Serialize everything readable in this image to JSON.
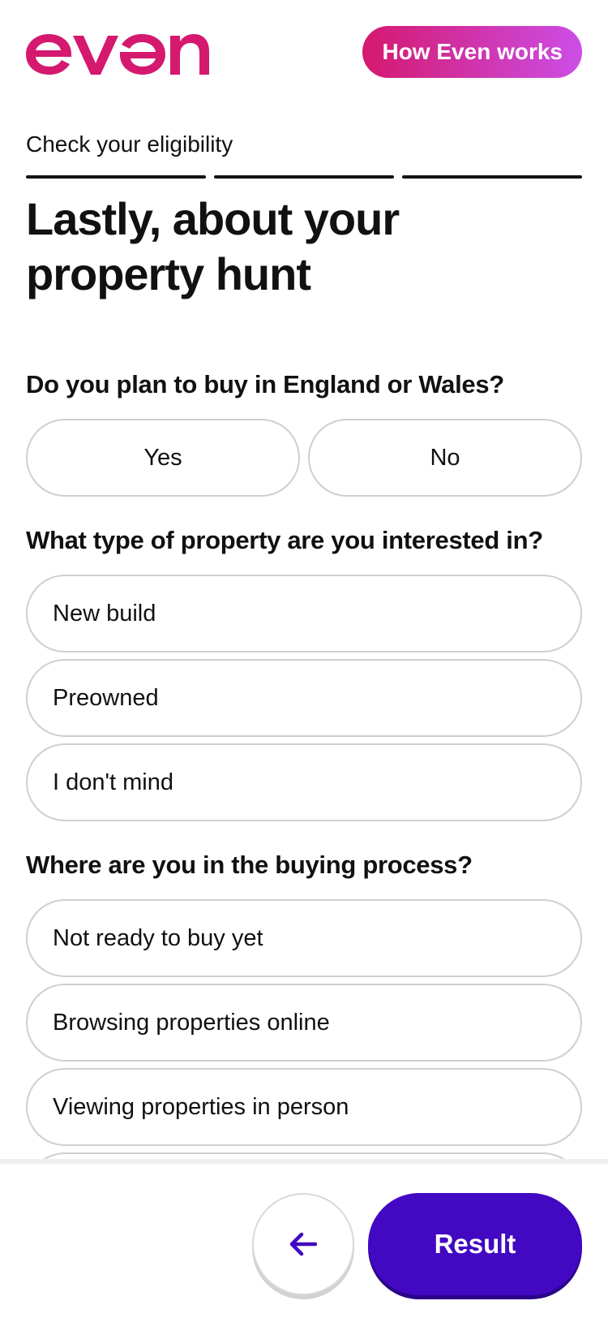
{
  "header": {
    "logo_text": "even",
    "how_button_label": "How Even works"
  },
  "progress": {
    "label": "Check your eligibility",
    "steps_total": 3,
    "steps_complete": 3
  },
  "title": "Lastly, about your property hunt",
  "questions": [
    {
      "text": "Do you plan to buy in England or Wales?",
      "options": [
        "Yes",
        "No"
      ]
    },
    {
      "text": "What type of property are you interested in?",
      "options": [
        "New build",
        "Preowned",
        "I don't mind"
      ]
    },
    {
      "text": "Where are you in the buying process?",
      "options": [
        "Not ready to buy yet",
        "Browsing properties online",
        "Viewing properties in person"
      ]
    }
  ],
  "footer": {
    "back_icon": "arrow-left-icon",
    "result_label": "Result"
  },
  "colors": {
    "brand_pink": "#d4196f",
    "brand_gradient_end": "#cc4ee6",
    "primary_purple": "#4208c2",
    "border_grey": "#cfcfcf"
  }
}
